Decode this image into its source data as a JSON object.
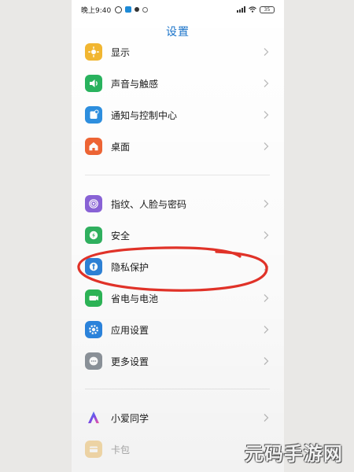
{
  "status_bar": {
    "time": "晚上9:40",
    "battery": "35"
  },
  "header": {
    "title": "设置"
  },
  "groups": [
    [
      {
        "label": "显示",
        "icon": "display-icon",
        "color": "#f2b731"
      },
      {
        "label": "声音与触感",
        "icon": "sound-icon",
        "color": "#29b35e"
      },
      {
        "label": "通知与控制中心",
        "icon": "notification-icon",
        "color": "#2d8fe0"
      },
      {
        "label": "桌面",
        "icon": "home-icon",
        "color": "#ef6535"
      }
    ],
    [
      {
        "label": "指纹、人脸与密码",
        "icon": "fingerprint-icon",
        "color": "#8a63d8"
      },
      {
        "label": "安全",
        "icon": "security-icon",
        "color": "#30b260"
      },
      {
        "label": "隐私保护",
        "icon": "privacy-icon",
        "color": "#2e82d8"
      },
      {
        "label": "省电与电池",
        "icon": "battery-icon",
        "color": "#2db657"
      },
      {
        "label": "应用设置",
        "icon": "app-settings-icon",
        "color": "#2c86e0"
      },
      {
        "label": "更多设置",
        "icon": "more-settings-icon",
        "color": "#8e959c"
      }
    ],
    [
      {
        "label": "小爱同学",
        "icon": "xiaoai-icon",
        "color": "#6f5af0"
      },
      {
        "label": "卡包",
        "icon": "wallet-icon",
        "color": "#f3c26a"
      }
    ]
  ],
  "watermark": "元码手游网"
}
